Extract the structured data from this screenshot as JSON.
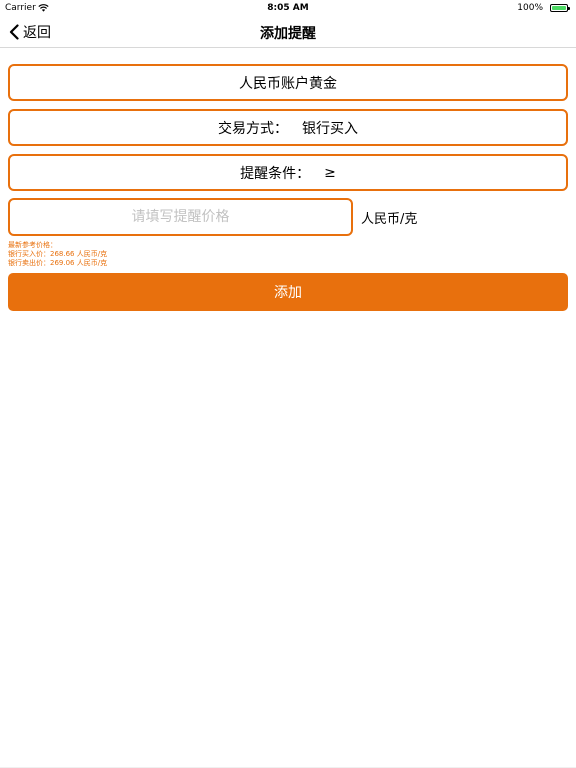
{
  "status_bar": {
    "carrier": "Carrier",
    "wifi_icon": "wifi-icon",
    "time": "8:05 AM",
    "battery_percent": "100%",
    "battery_icon": "battery-icon",
    "battery_level": 1.0,
    "battery_color": "#4cd964"
  },
  "nav": {
    "back_icon": "chevron-left-icon",
    "back_label": "返回",
    "title": "添加提醒"
  },
  "form": {
    "account": "人民币账户黄金",
    "trade_method_label": "交易方式：",
    "trade_method_value": "银行买入",
    "condition_label": "提醒条件：",
    "condition_value": "≥",
    "price_placeholder": "请填写提醒价格",
    "price_value": "",
    "unit": "人民币/克"
  },
  "reference": {
    "title": "最新参考价格：",
    "buy_line": "银行买入价：268.66 人民币/克",
    "sell_line": "银行卖出价：269.06 人民币/克"
  },
  "actions": {
    "add_label": "添加"
  },
  "colors": {
    "accent": "#e8700d",
    "placeholder": "#c2c2c2",
    "divider": "#d8d8d8"
  }
}
